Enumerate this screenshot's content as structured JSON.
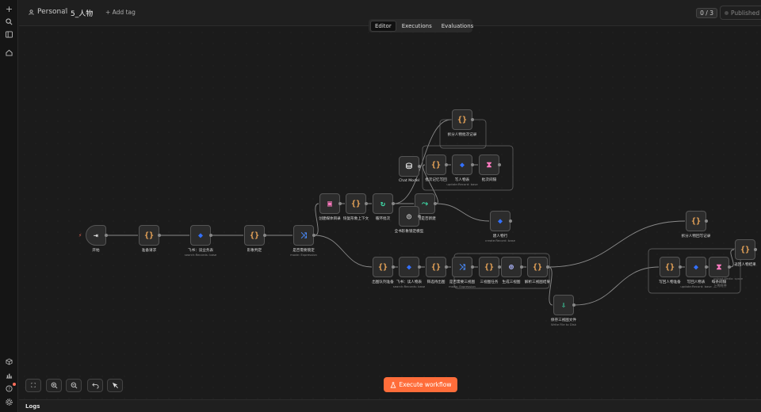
{
  "header": {
    "project": "Personal",
    "separator": "/",
    "workflow_name": "5_人物",
    "add_tag": "+ Add tag",
    "counter": "0 / 3",
    "published": "Published",
    "tabs": [
      {
        "label": "Editor",
        "active": true
      },
      {
        "label": "Executions",
        "active": false
      },
      {
        "label": "Evaluations",
        "active": false
      }
    ]
  },
  "sidebar": {
    "top_icons": [
      "plus-icon",
      "search-icon",
      "panel-icon",
      "home-icon"
    ],
    "bottom_icons": [
      "cube-icon",
      "chart-icon",
      "help-icon",
      "gear-icon"
    ]
  },
  "nodes": [
    {
      "id": "start",
      "label": "开始",
      "sub": "",
      "icon": "⇥",
      "color": "#dddddd",
      "kind": "trigger"
    },
    {
      "id": "prep",
      "label": "准备请求",
      "sub": "",
      "icon": "{}",
      "color": "#f0a95a"
    },
    {
      "id": "feishu_read",
      "label": "飞书：读业务表",
      "sub": "search:Records: base",
      "icon": "◆",
      "color": "#3370ff"
    },
    {
      "id": "judge",
      "label": "形象判定",
      "sub": "",
      "icon": "{}",
      "color": "#f0a95a"
    },
    {
      "id": "switch",
      "label": "是否需要锁定",
      "sub": "mode: Expression",
      "icon": "⤨",
      "color": "#4a8cff"
    },
    {
      "id": "mkdir",
      "label": "创建媒体目录",
      "sub": "",
      "icon": "▣",
      "color": "#ff7ac0"
    },
    {
      "id": "restore",
      "label": "恢复形象上下文",
      "sub": "",
      "icon": "{}",
      "color": "#f0a95a"
    },
    {
      "id": "loop",
      "label": "循环批次",
      "sub": "",
      "icon": "↻",
      "color": "#3ed6a4"
    },
    {
      "id": "chat",
      "label": "Chat Model",
      "sub": "",
      "icon": "⛁",
      "color": "#dddddd"
    },
    {
      "id": "if_new",
      "label": "人物是否新建",
      "sub": "",
      "icon": "⤳",
      "color": "#3ed6a4"
    },
    {
      "id": "openai",
      "label": "全书形象锁定模型",
      "sub": "",
      "icon": "◎",
      "color": "#dddddd"
    },
    {
      "id": "split_top",
      "label": "拆分人物批次记录",
      "sub": "",
      "icon": "{}",
      "color": "#f0a95a"
    },
    {
      "id": "batch_code",
      "label": "批次记忆写回",
      "sub": "",
      "icon": "{}",
      "color": "#f0a95a"
    },
    {
      "id": "write_person",
      "label": "写人物表",
      "sub": "update:Record: base",
      "icon": "◆",
      "color": "#3370ff"
    },
    {
      "id": "wait",
      "label": "批次间隔",
      "sub": "",
      "icon": "⧗",
      "color": "#ff7ac0"
    },
    {
      "id": "new_person",
      "label": "建人物行",
      "sub": "create:Record: base",
      "icon": "◆",
      "color": "#3370ff"
    },
    {
      "id": "queue_prep",
      "label": "出图队列准备",
      "sub": "",
      "icon": "{}",
      "color": "#f0a95a"
    },
    {
      "id": "feishu_read2",
      "label": "飞书：读人物表",
      "sub": "search:Records: base",
      "icon": "◆",
      "color": "#3370ff"
    },
    {
      "id": "filter",
      "label": "筛选待出图",
      "sub": "",
      "icon": "{}",
      "color": "#f0a95a"
    },
    {
      "id": "switch2",
      "label": "是否需要三视图",
      "sub": "mode: Expression",
      "icon": "⤨",
      "color": "#4a8cff"
    },
    {
      "id": "task3",
      "label": "三视图任务",
      "sub": "",
      "icon": "{}",
      "color": "#f0a95a"
    },
    {
      "id": "http3",
      "label": "生成三视图",
      "sub": "",
      "icon": "⊕",
      "color": "#b0b8ff"
    },
    {
      "id": "parse3",
      "label": "解析三视图结果",
      "sub": "",
      "icon": "{}",
      "color": "#f0a95a"
    },
    {
      "id": "save_file",
      "label": "保存三视图文件",
      "sub": "Write File to Disk",
      "icon": "⇩",
      "color": "#3ed6a4"
    },
    {
      "id": "split_r",
      "label": "拆分人物回写记录",
      "sub": "",
      "icon": "{}",
      "color": "#f0a95a"
    },
    {
      "id": "wb_prep",
      "label": "写回人物准备",
      "sub": "",
      "icon": "{}",
      "color": "#f0a95a"
    },
    {
      "id": "wb_person",
      "label": "写回人物表",
      "sub": "update:Record: base",
      "icon": "◆",
      "color": "#3370ff"
    },
    {
      "id": "wait2",
      "label": "每条间隔",
      "sub": "",
      "icon": "⧗",
      "color": "#ff7ac0"
    },
    {
      "id": "upload",
      "label": "上传附件",
      "sub": "upload:Media: space",
      "icon": "{}",
      "color": "#f0a95a"
    },
    {
      "id": "return",
      "label": "返回人物结果",
      "sub": "",
      "icon": "{}",
      "color": "#f0a95a"
    }
  ],
  "controls": {
    "execute_label": "Execute workflow",
    "execute_color": "#ff6d3a"
  },
  "logs": {
    "label": "Logs"
  }
}
